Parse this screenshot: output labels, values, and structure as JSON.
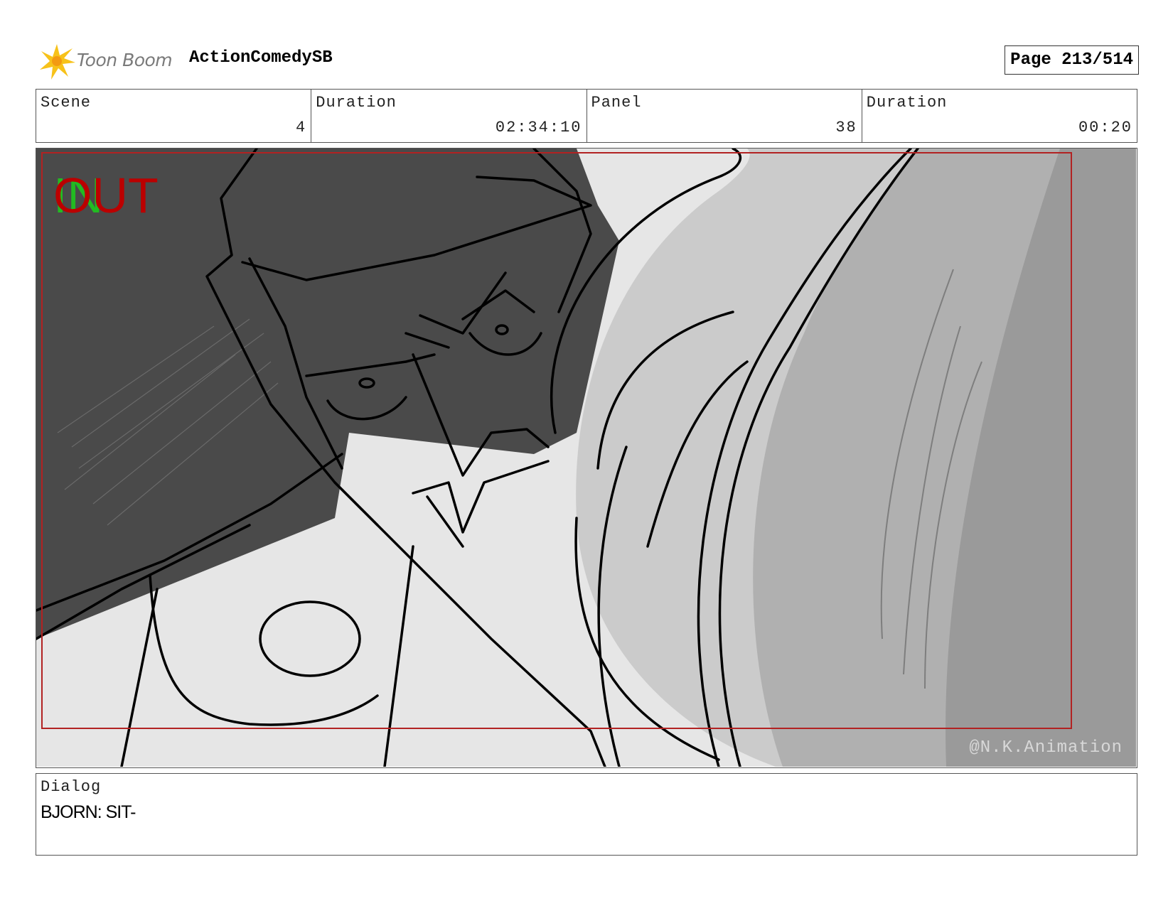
{
  "header": {
    "logo_text": "Toon Boom",
    "project_title": "ActionComedySB",
    "page": "Page 213/514"
  },
  "info": {
    "scene_label": "Scene",
    "scene_value": "4",
    "scene_duration_label": "Duration",
    "scene_duration_value": "02:34:10",
    "panel_label": "Panel",
    "panel_value": "38",
    "panel_duration_label": "Duration",
    "panel_duration_value": "00:20"
  },
  "panel": {
    "in_marker": "IN",
    "out_marker": "OUT",
    "watermark": "@N.K.Animation"
  },
  "dialog": {
    "label": "Dialog",
    "text": "BJORN: SIT-"
  },
  "colors": {
    "safe_frame": "#b22222",
    "in_marker": "#22bb22",
    "out_marker": "#bb0000"
  }
}
